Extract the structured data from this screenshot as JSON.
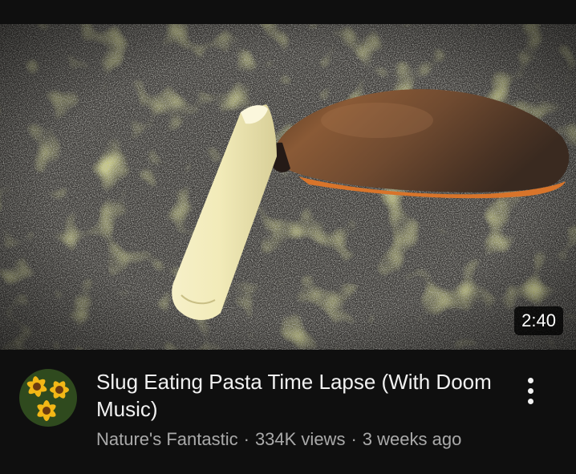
{
  "video": {
    "title": "Slug Eating Pasta Time Lapse (With Doom Music)",
    "duration": "2:40",
    "channel": "Nature's Fantastic",
    "views": "334K views",
    "age": "3 weeks ago",
    "separator": "·"
  },
  "icons": {
    "menu": "more-vert-icon",
    "avatar": "sunflower-avatar"
  }
}
